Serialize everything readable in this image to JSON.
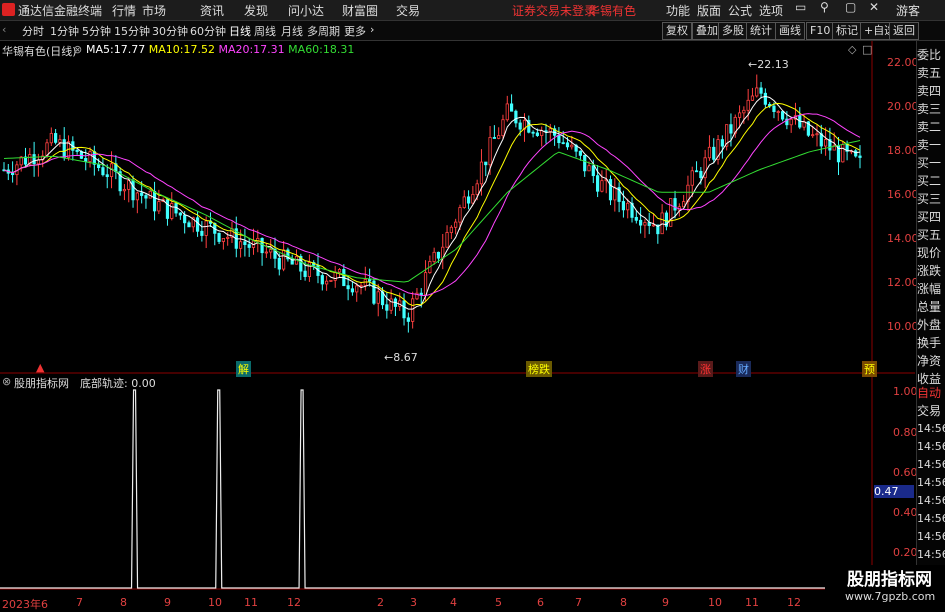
{
  "app": {
    "title": "通达信金融终端",
    "menu": [
      "行情",
      "市场",
      "资讯",
      "发现",
      "问小达",
      "财富圈",
      "交易"
    ],
    "notice": "证券交易未登录",
    "stock_name_top": "华锡有色",
    "right_menu": [
      "功能",
      "版面",
      "公式",
      "选项"
    ],
    "guest": "游客"
  },
  "toolbar": {
    "periods": [
      "分时",
      "1分钟",
      "5分钟",
      "15分钟",
      "30分钟",
      "60分钟",
      "日线",
      "周线",
      "月线",
      "多周期",
      "更多"
    ],
    "active_period": "日线",
    "right_buttons": [
      "复权",
      "叠加",
      "多股",
      "统计",
      "画线",
      "F10",
      "标记",
      "+自选",
      "返回"
    ]
  },
  "main_chart": {
    "stock_label": "华锡有色(日线)",
    "ma": [
      {
        "name": "MA5:",
        "value": "17.77",
        "color": "#ffffff"
      },
      {
        "name": "MA10:",
        "value": "17.52",
        "color": "#ffff00"
      },
      {
        "name": "MA20:",
        "value": "17.31",
        "color": "#ff44ff"
      },
      {
        "name": "MA60:",
        "value": "18.31",
        "color": "#33dd33"
      }
    ],
    "y_ticks": [
      "22.00",
      "20.00",
      "18.00",
      "16.00",
      "14.00",
      "12.00",
      "10.00"
    ],
    "high_label": "22.13",
    "low_label": "8.67",
    "markers": [
      "解",
      "榜跌",
      "涨",
      "财",
      "预"
    ]
  },
  "sub_chart": {
    "label": "股朋指标网",
    "indicator": "底部轨迹: 0.00",
    "y_ticks": [
      "1.00",
      "0.80",
      "0.60",
      "0.40",
      "0.20"
    ],
    "cursor_value": "0.47"
  },
  "x_ticks": [
    "2023年6",
    "7",
    "8",
    "9",
    "10",
    "11",
    "12",
    "2",
    "3",
    "4",
    "5",
    "6",
    "7",
    "8",
    "9",
    "10",
    "11",
    "12"
  ],
  "right_panel": {
    "quote_items": [
      "委比",
      "卖五",
      "卖四",
      "卖三",
      "卖二",
      "卖一",
      "买一",
      "买二",
      "买三",
      "买四",
      "买五",
      "现价",
      "涨跌",
      "涨幅",
      "总量",
      "外盘",
      "换手",
      "净资",
      "收益"
    ],
    "auto_label": "自动",
    "trade_label": "交易",
    "times": [
      "14:56",
      "14:56",
      "14:56",
      "14:56",
      "14:56",
      "14:56",
      "14:56",
      "14:56",
      "14:56"
    ]
  },
  "watermark": {
    "line1": "股朋指标网",
    "line2": "www.7gpzb.com"
  },
  "chart_data": {
    "type": "candlestick",
    "title": "华锡有色(日线)",
    "ylim": [
      8.5,
      22.5
    ],
    "close_path_x": [
      "2023年6",
      "7",
      "8",
      "9",
      "10",
      "11",
      "12",
      "2",
      "3",
      "4",
      "5",
      "6",
      "7",
      "8",
      "9",
      "10",
      "11",
      "12"
    ],
    "approx_close": [
      17.0,
      18.2,
      17.0,
      15.5,
      14.5,
      13.5,
      12.5,
      12.0,
      10.5,
      15.0,
      19.5,
      18.5,
      16.0,
      14.5,
      17.5,
      20.5,
      18.5,
      17.2
    ],
    "ma60_approx": [
      17.5,
      17.6,
      17.2,
      16.0,
      15.0,
      13.8,
      12.8,
      12.2,
      12.0,
      13.5,
      16.0,
      17.8,
      17.0,
      16.0,
      16.0,
      17.0,
      17.8,
      18.3
    ],
    "sub_indicator": {
      "name": "底部轨迹",
      "spikes_at_x_fraction": [
        0.155,
        0.252,
        0.348
      ],
      "spike_value": 1.0,
      "baseline": 0.0
    }
  }
}
